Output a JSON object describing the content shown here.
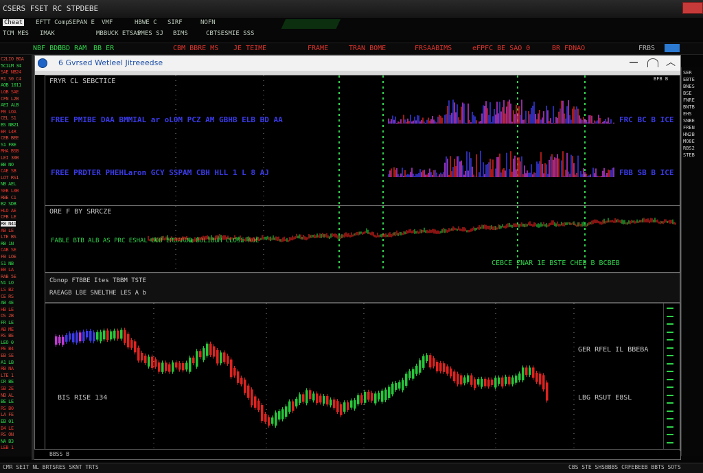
{
  "window": {
    "app_title": "CSERS FSET RC STPDEBE"
  },
  "menu_rows": [
    {
      "items": [
        {
          "label": "Cheat",
          "selected": true
        },
        {
          "label": "EFTT Comp"
        },
        {
          "label": "SEPAN E"
        },
        {
          "label": "VMF"
        },
        {
          "label": "HBWE C"
        },
        {
          "label": "SIRF"
        },
        {
          "label": "NOFN"
        }
      ]
    },
    {
      "items": [
        {
          "label": "TCM MES"
        },
        {
          "label": "IMAK"
        },
        {
          "label": "MBBUCK ETSAS"
        },
        {
          "label": "PMES SJ"
        },
        {
          "label": "BIMS"
        },
        {
          "label": "CBTSESMIE SSS"
        }
      ]
    }
  ],
  "ticker": {
    "items": [
      {
        "text": "NBF BDD",
        "color": "#2fd34a"
      },
      {
        "text": "EBD RAM",
        "color": "#2fd34a"
      },
      {
        "text": "BB ER",
        "color": "#2fd34a"
      },
      {
        "text": "CBM BBRE MS",
        "color": "#e0342c"
      },
      {
        "text": "JE TEIME",
        "color": "#e0342c"
      },
      {
        "text": "FRAME",
        "color": "#e0342c"
      },
      {
        "text": "TRAN BOME",
        "color": "#e0342c"
      },
      {
        "text": "FRSAABIMS",
        "color": "#e0342c"
      },
      {
        "text": "eFPFC BE SAO 0",
        "color": "#e0342c"
      },
      {
        "text": "BR FDNAO",
        "color": "#e0342c"
      }
    ],
    "end_label": "FRBS"
  },
  "left_panel_rows": [
    "C2LIO BOA",
    "5C1LM 34",
    "SAE NB24",
    "R1 S0 C4",
    "AOB 1011",
    "LGB SAE",
    "CFN L2B",
    "AEI ALB",
    "FB LOA",
    "CEL S1",
    "BS NB21",
    "ER L4R",
    "CEB BEE",
    "S1 F8E",
    "RHA BSB",
    "LEI 30B",
    "BB NO",
    "CAE SB",
    "LOT RS1",
    "NB AEL",
    "SEB L0B",
    "RBE C1",
    "B2 SDB",
    "HLO AE",
    "CFB LE",
    "R8 N41",
    "AB LE",
    "LTE BS",
    "RB 1N",
    "CAB SE",
    "FB LOE",
    "S1 NB",
    "EB LA",
    "RAB 5E",
    "N1 LO",
    "LS B2",
    "CE RS",
    "AB 4E",
    "HB LE",
    "OS 2B",
    "FR LE",
    "AB ME",
    "RS BE",
    "LEO 0",
    "PE B4",
    "EB SE",
    "A1 LB",
    "RB NA",
    "LTE 1",
    "CR BE",
    "SB 2E",
    "NB AL",
    "BE LE",
    "RS B0",
    "LA FE",
    "EB 01",
    "B4 LE",
    "RS ON",
    "NA B3",
    "LEB 1"
  ],
  "right_panel_rows": [
    "SER",
    "EBTE",
    "BNES",
    "BSE",
    "FNRE",
    "BNTB",
    "EHS",
    "SNBE",
    "FREN",
    "HN2B",
    "MO8E",
    "RBS2",
    "STEB"
  ],
  "chart_window": {
    "title": "6 Gvrsed   Wetleel Jitreeedse",
    "pane1": {
      "label": "FRYR  CL SEBCTICE",
      "row1": "FREE   PMIBE  DAA  BMMIAL ar oLOM  PCZ  AM  GBHB  ELB BD  AA",
      "row2": "FREE   PRDTER  PHEHLaron GCY  SSPAM  CBH HLL 1 L 8  AJ",
      "row1_right": "FRC BC B ICE",
      "row2_right": "FBB SB B ICE",
      "corner": "BFB B"
    },
    "pane2": {
      "label": "ORE F BY SRRCZE",
      "row": "FABLE  BTB  ALB  AS  PRC  ESHAL  BOB  ERBAROB  BOLIBUM  CLOSE  AOE",
      "bottom_right": "CEBCE   ZNAR  1E  BSTE   CHEB  B   BCBEB"
    },
    "info": {
      "line1": "Cbnop  FTBBE  Ites  TBBM  TSTE",
      "line2": "RAEAGB   LBE  SNELTHE  LES    A   b"
    },
    "pane3": {
      "label_right_top": "GER  RFEL IL  BBEBA",
      "label_left": "BIS  RISE  134",
      "label_right_bottom": "LBG  RSUT  E8SL",
      "bottom": "BBSS B"
    }
  },
  "status": {
    "left": "CMR SEIT NL  BRTSRES SKNT  TRTS",
    "right": "CBS STE SHSBBBS CRFEBEEB BBTS SOTS"
  },
  "colors": {
    "up": "#25c93a",
    "down": "#e0231f",
    "blue_series": "#3a3ae8",
    "magenta": "#c23bd4",
    "grid_green": "#2fd34a"
  }
}
